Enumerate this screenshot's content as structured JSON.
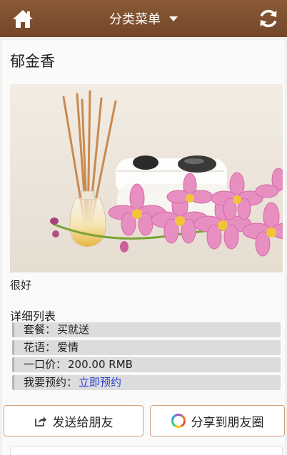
{
  "header": {
    "title": "分类菜单",
    "home_icon": "home-icon",
    "refresh_icon": "refresh-icon",
    "dropdown_icon": "caret-down-icon",
    "bar_color": "#7d4e2f"
  },
  "page": {
    "title": "郁金香",
    "image_desc_icon": "orchid-reed-diffuser-photo",
    "description": "很好"
  },
  "details": {
    "heading": "详细列表",
    "rows": [
      {
        "label": "套餐：",
        "value": "买就送"
      },
      {
        "label": "花语：",
        "value": "爱情"
      },
      {
        "label": "一口价：",
        "value": "200.00 RMB"
      },
      {
        "label": "我要预约：",
        "value": "立即预约"
      }
    ],
    "link_color": "#2a3fd1"
  },
  "actions": {
    "send_label": "发送给朋友",
    "send_icon": "share-icon",
    "moments_label": "分享到朋友圈",
    "moments_icon": "moments-icon"
  }
}
